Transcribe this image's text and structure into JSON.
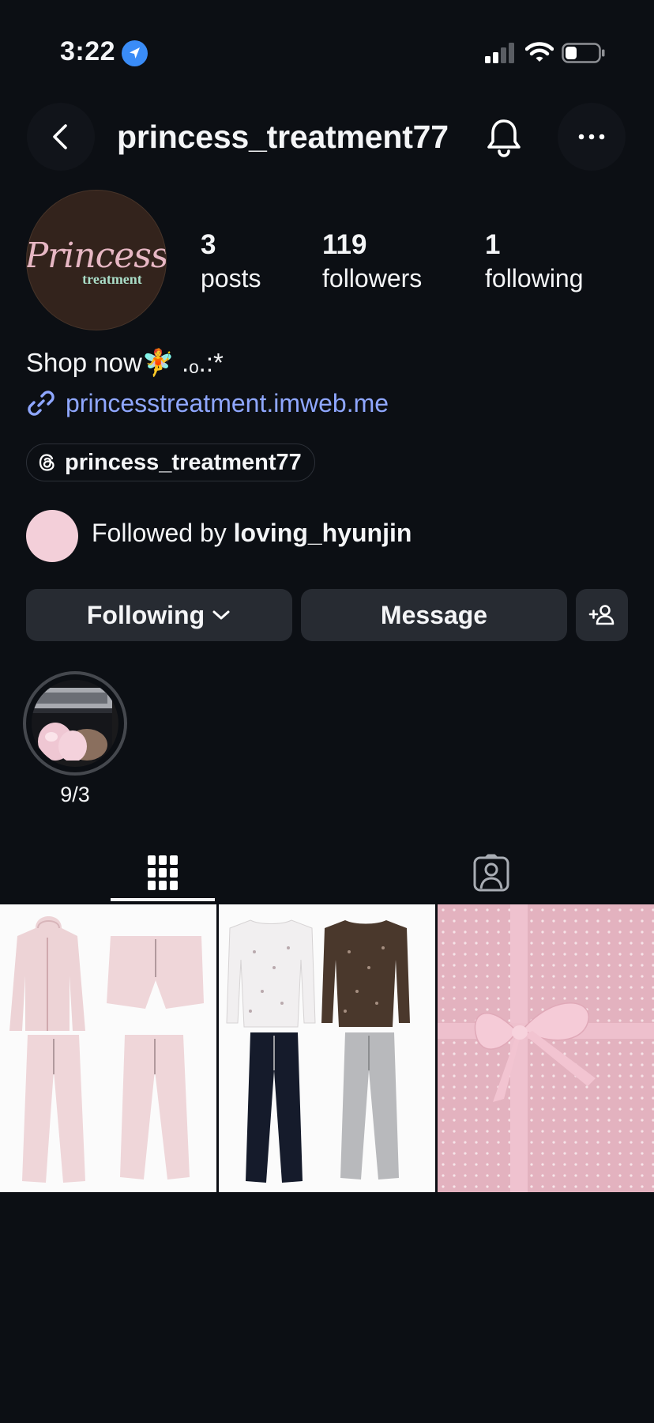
{
  "status_bar": {
    "time": "3:22"
  },
  "header": {
    "username": "princess_treatment77"
  },
  "profile": {
    "avatar_text_1": "Princess",
    "avatar_text_2": "treatment",
    "stats": [
      {
        "value": "3",
        "label": "posts"
      },
      {
        "value": "119",
        "label": "followers"
      },
      {
        "value": "1",
        "label": "following"
      }
    ],
    "bio": "Shop now🧚 .ₒ.:*",
    "link": "princesstreatment.imweb.me",
    "threads_handle": "princess_treatment77",
    "followed_by_prefix": "Followed by ",
    "followed_by_user": "loving_hyunjin"
  },
  "actions": {
    "following_label": "Following",
    "message_label": "Message"
  },
  "highlights": [
    {
      "label": "9/3"
    }
  ],
  "tabs": {
    "active": "grid"
  },
  "colors": {
    "background": "#0c0f14",
    "button": "#272b32",
    "link": "#8fa7ff",
    "location": "#3a8cf7"
  }
}
